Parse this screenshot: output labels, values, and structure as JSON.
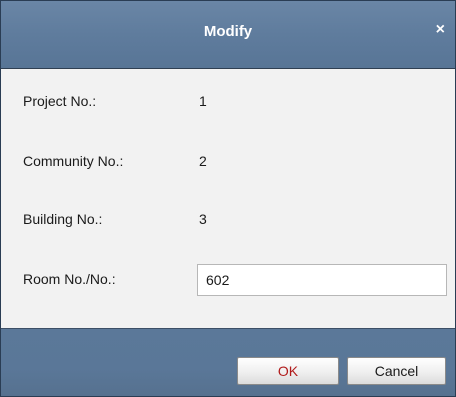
{
  "dialog": {
    "title": "Modify",
    "close_glyph": "×"
  },
  "fields": [
    {
      "label": "Project No.:",
      "value": "1"
    },
    {
      "label": "Community No.:",
      "value": "2"
    },
    {
      "label": "Building No.:",
      "value": "3"
    }
  ],
  "room": {
    "label": "Room No./No.:",
    "value": "602"
  },
  "buttons": {
    "ok_label": "OK",
    "cancel_label": "Cancel"
  },
  "colors": {
    "header": "#5f7c9d",
    "body": "#f2f2f2",
    "ok_text": "#b11b1b"
  }
}
